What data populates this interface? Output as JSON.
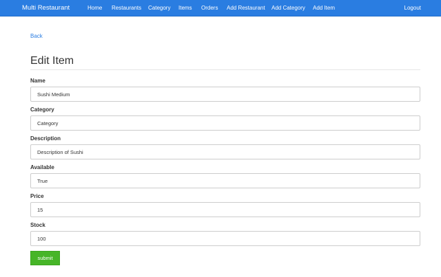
{
  "navbar": {
    "brand": "Multi Restaurant",
    "links": [
      "Home",
      "Restaurants",
      "Category",
      "Items",
      "Orders",
      "Add Restaurant",
      "Add Category",
      "Add Item"
    ],
    "logout": "Logout",
    "color": "#2a7de1"
  },
  "back_link": "Back",
  "page_title": "Edit Item",
  "form": {
    "fields": [
      {
        "label": "Name",
        "value": "Sushi Medium"
      },
      {
        "label": "Category",
        "value": "Category"
      },
      {
        "label": "Description",
        "value": "Description of Sushi"
      },
      {
        "label": "Available",
        "value": "True"
      },
      {
        "label": "Price",
        "value": "15"
      },
      {
        "label": "Stock",
        "value": "100"
      }
    ],
    "submit_label": "submit",
    "submit_color": "#46b528"
  }
}
